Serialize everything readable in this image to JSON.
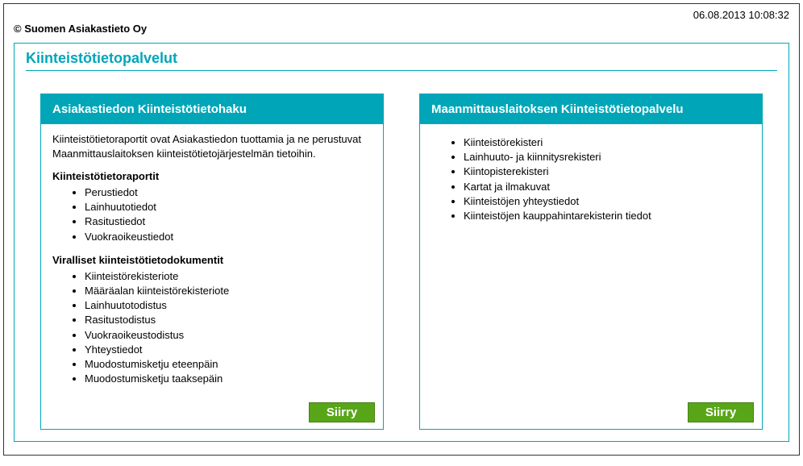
{
  "timestamp": "06.08.2013 10:08:32",
  "copyright": "© Suomen Asiakastieto Oy",
  "title": "Kiinteistötietopalvelut",
  "left": {
    "header": "Asiakastiedon Kiinteistötietohaku",
    "intro": "Kiinteistötietoraportit ovat Asiakastiedon tuottamia ja ne perustuvat Maanmittauslaitoksen kiinteistötietojärjestelmän tietoihin.",
    "section1_title": "Kiinteistötietoraportit",
    "section1_items": [
      "Perustiedot",
      "Lainhuutotiedot",
      "Rasitustiedot",
      "Vuokraoikeustiedot"
    ],
    "section2_title": "Viralliset kiinteistötietodokumentit",
    "section2_items": [
      "Kiinteistörekisteriote",
      "Määräalan kiinteistörekisteriote",
      "Lainhuutotodistus",
      "Rasitustodistus",
      "Vuokraoikeustodistus",
      "Yhteystiedot",
      "Muodostumisketju eteenpäin",
      "Muodostumisketju taaksepäin"
    ],
    "button": "Siirry"
  },
  "right": {
    "header": "Maanmittauslaitoksen Kiinteistötietopalvelu",
    "items": [
      "Kiinteistörekisteri",
      "Lainhuuto- ja kiinnitysrekisteri",
      "Kiintopisterekisteri",
      "Kartat ja ilmakuvat",
      "Kiinteistöjen yhteystiedot",
      "Kiinteistöjen kauppahintarekisterin tiedot"
    ],
    "button": "Siirry"
  }
}
